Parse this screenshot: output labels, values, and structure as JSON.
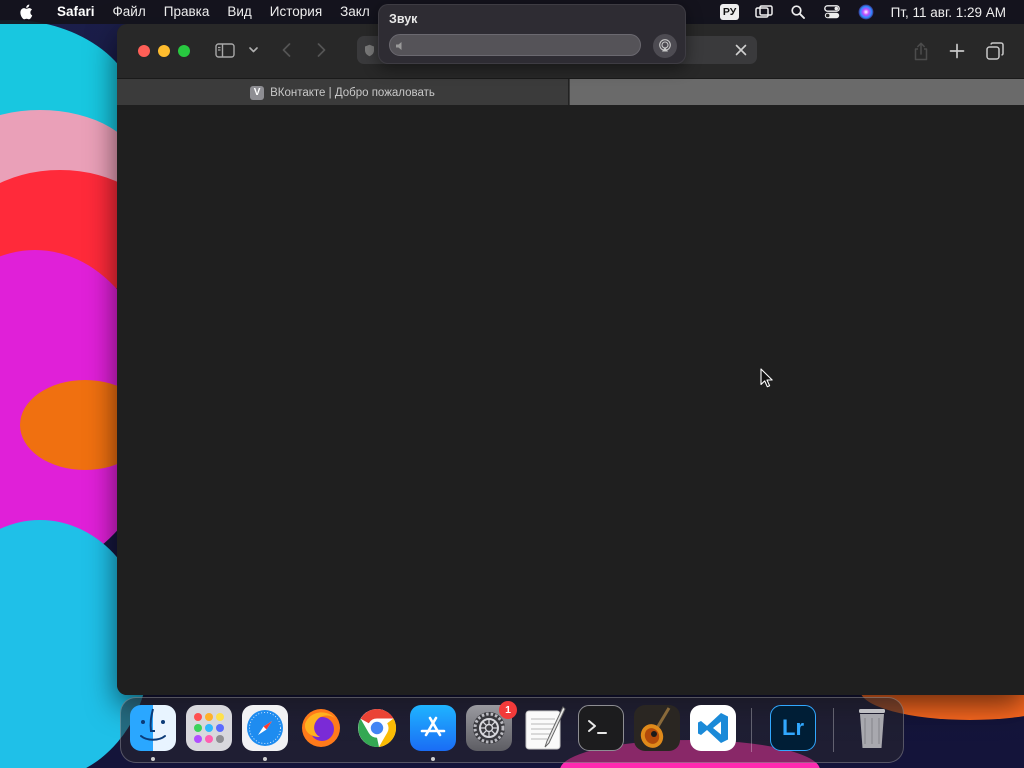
{
  "menubar": {
    "app_name": "Safari",
    "menus": [
      "Файл",
      "Правка",
      "Вид",
      "История",
      "Закл"
    ],
    "language": "РУ",
    "clock": "Пт, 11 авг. 1:29 AM"
  },
  "sound_popup": {
    "title": "Звук",
    "volume_level": 0
  },
  "browser": {
    "tab_active_title": "ВКонтакте | Добро пожаловать",
    "favicon_letter": "V"
  },
  "dock": {
    "apps": [
      {
        "name": "Finder",
        "icon": "finder-icon",
        "running": true
      },
      {
        "name": "Launchpad",
        "icon": "launchpad-icon",
        "running": false
      },
      {
        "name": "Safari",
        "icon": "safari-icon",
        "running": true
      },
      {
        "name": "Firefox",
        "icon": "firefox-icon",
        "running": false
      },
      {
        "name": "Google Chrome",
        "icon": "chrome-icon",
        "running": false
      },
      {
        "name": "App Store",
        "icon": "app-store-icon",
        "running": true
      },
      {
        "name": "System Settings",
        "icon": "system-settings-icon",
        "running": false,
        "badge": "1"
      },
      {
        "name": "TextEdit",
        "icon": "textedit-icon",
        "running": false
      },
      {
        "name": "Terminal",
        "icon": "terminal-icon",
        "running": false
      },
      {
        "name": "GarageBand",
        "icon": "garageband-icon",
        "running": false
      },
      {
        "name": "Visual Studio Code",
        "icon": "vscode-icon",
        "running": false
      },
      {
        "name": "Lightroom",
        "icon": "lightroom-icon",
        "running": false,
        "label": "Lr"
      },
      {
        "name": "Trash",
        "icon": "trash-icon",
        "running": false
      }
    ]
  },
  "colors": {
    "window_bg": "#1e1e1e",
    "toolbar_bg": "#282828",
    "traffic_close": "#fe5f57",
    "traffic_min": "#febc2e",
    "traffic_max": "#28c840",
    "badge": "#f23a3a"
  }
}
